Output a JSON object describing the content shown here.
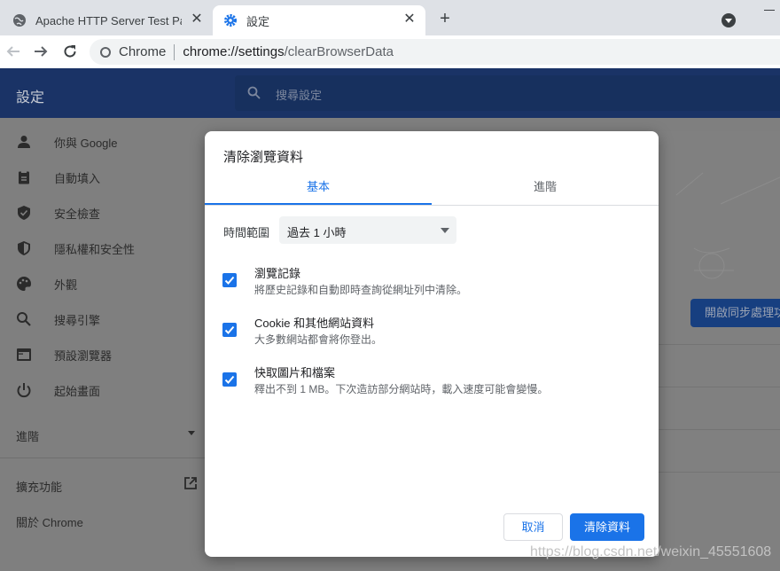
{
  "tabs": [
    {
      "title": "Apache HTTP Server Test Page",
      "icon": "globe-icon",
      "close": "✕"
    },
    {
      "title": "設定",
      "icon": "settings-gear-icon",
      "close": "✕"
    }
  ],
  "toolbar": {
    "new_tab": "+",
    "omnibox_chip": "Chrome",
    "url_host": "chrome://settings",
    "url_path": "/clearBrowserData"
  },
  "settings": {
    "title": "設定",
    "search_placeholder": "搜尋設定",
    "sidebar": [
      {
        "label": "你與 Google",
        "icon": "person-icon"
      },
      {
        "label": "自動填入",
        "icon": "clipboard-icon"
      },
      {
        "label": "安全檢查",
        "icon": "shield-check-icon"
      },
      {
        "label": "隱私權和安全性",
        "icon": "shield-icon"
      },
      {
        "label": "外觀",
        "icon": "palette-icon"
      },
      {
        "label": "搜尋引擎",
        "icon": "search-icon"
      },
      {
        "label": "預設瀏覽器",
        "icon": "browser-icon"
      },
      {
        "label": "起始畫面",
        "icon": "power-icon"
      }
    ],
    "advanced": "進階",
    "extensions": "擴充功能",
    "about": "關於 Chrome",
    "sync_button": "開啟同步處理功"
  },
  "dialog": {
    "title": "清除瀏覽資料",
    "tab_basic": "基本",
    "tab_advanced": "進階",
    "time_range_label": "時間範圍",
    "time_range_value": "過去 1 小時",
    "options": [
      {
        "title": "瀏覽記錄",
        "desc": "將歷史記錄和自動即時查詢從網址列中清除。",
        "checked": true
      },
      {
        "title": "Cookie 和其他網站資料",
        "desc": "大多數網站都會將你登出。",
        "checked": true
      },
      {
        "title": "快取圖片和檔案",
        "desc": "釋出不到 1 MB。下次造訪部分網站時，載入速度可能會變慢。",
        "checked": true
      }
    ],
    "cancel": "取消",
    "clear": "清除資料"
  },
  "watermark": "https://blog.csdn.net/weixin_45551608",
  "colors": {
    "accent": "#1a73e8",
    "header": "#1a3366"
  }
}
